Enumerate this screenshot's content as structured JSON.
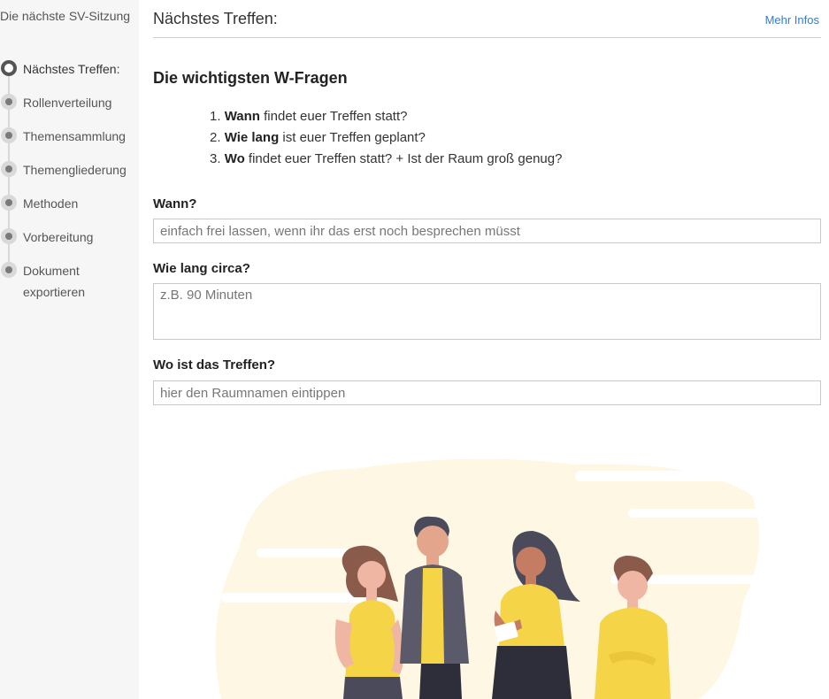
{
  "sidebar": {
    "title": "Die nächste SV-Sitzung",
    "steps": [
      {
        "label": "Nächstes Treffen:",
        "active": true
      },
      {
        "label": "Rollenverteilung",
        "active": false
      },
      {
        "label": "Themensammlung",
        "active": false
      },
      {
        "label": "Themengliederung",
        "active": false
      },
      {
        "label": "Methoden",
        "active": false
      },
      {
        "label": "Vorbereitung",
        "active": false
      },
      {
        "label": "Dokument exportieren",
        "active": false
      }
    ]
  },
  "header": {
    "title": "Nächstes Treffen:",
    "more_link": "Mehr Infos"
  },
  "section": {
    "heading": "Die wichtigsten W-Fragen",
    "questions": [
      {
        "num": "1.",
        "bold": "Wann",
        "rest": " findet euer Treffen statt?"
      },
      {
        "num": "2.",
        "bold": "Wie lang",
        "rest": " ist euer Treffen geplant?"
      },
      {
        "num": "3.",
        "bold": "Wo",
        "rest": " findet euer Treffen statt? + Ist der Raum groß genug?"
      }
    ]
  },
  "form": {
    "when": {
      "label": "Wann?",
      "value": "",
      "placeholder": "einfach frei lassen, wenn ihr das erst noch besprechen müsst"
    },
    "duration": {
      "label": "Wie lang circa?",
      "value": "",
      "placeholder": "z.B. 90 Minuten"
    },
    "where": {
      "label": "Wo ist das Treffen?",
      "value": "",
      "placeholder": "hier den Raumnamen eintippen"
    }
  },
  "colors": {
    "accent_link": "#3a7bc8",
    "illustration_yellow": "#f5d547",
    "illustration_bg": "#fdf7e3"
  }
}
